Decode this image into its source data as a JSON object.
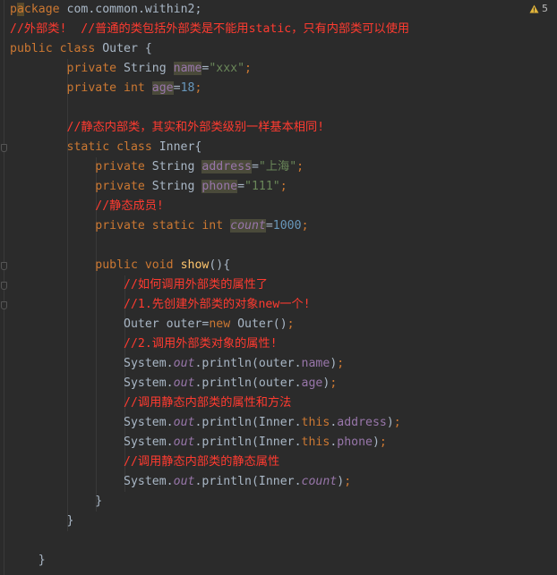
{
  "editor": {
    "warning_count": "5",
    "lines": [
      [
        {
          "t": "p",
          "c": "kw"
        },
        {
          "t": "a",
          "c": "caret-hl"
        },
        {
          "t": "ckage ",
          "c": "kw"
        },
        {
          "t": "com.common.within2;",
          "c": "plain"
        }
      ],
      [
        {
          "t": "//外部类!  //普通的类包括外部类是不能用static，只有内部类可以使用",
          "c": "cm"
        }
      ],
      [
        {
          "t": "public class ",
          "c": "kw"
        },
        {
          "t": "Outer {",
          "c": "plain"
        }
      ],
      [
        {
          "t": "        private ",
          "c": "kw"
        },
        {
          "t": "String ",
          "c": "plain"
        },
        {
          "t": "name",
          "c": "fld-hl"
        },
        {
          "t": "=",
          "c": "plain"
        },
        {
          "t": "\"xxx\"",
          "c": "str"
        },
        {
          "t": ";",
          "c": "kw"
        }
      ],
      [
        {
          "t": "        private int ",
          "c": "kw"
        },
        {
          "t": "age",
          "c": "fld-hl"
        },
        {
          "t": "=",
          "c": "plain"
        },
        {
          "t": "18",
          "c": "num"
        },
        {
          "t": ";",
          "c": "kw"
        }
      ],
      [],
      [
        {
          "t": "        //静态内部类，其实和外部类级别一样基本相同!",
          "c": "cm"
        }
      ],
      [
        {
          "t": "        static class ",
          "c": "kw"
        },
        {
          "t": "Inner{",
          "c": "plain"
        }
      ],
      [
        {
          "t": "            private ",
          "c": "kw"
        },
        {
          "t": "String ",
          "c": "plain"
        },
        {
          "t": "address",
          "c": "fld-hl"
        },
        {
          "t": "=",
          "c": "plain"
        },
        {
          "t": "\"上海\"",
          "c": "str"
        },
        {
          "t": ";",
          "c": "kw"
        }
      ],
      [
        {
          "t": "            private ",
          "c": "kw"
        },
        {
          "t": "String ",
          "c": "plain"
        },
        {
          "t": "phone",
          "c": "fld-hl"
        },
        {
          "t": "=",
          "c": "plain"
        },
        {
          "t": "\"111\"",
          "c": "str"
        },
        {
          "t": ";",
          "c": "kw"
        }
      ],
      [
        {
          "t": "            //静态成员!",
          "c": "cm"
        }
      ],
      [
        {
          "t": "            private static int ",
          "c": "kw"
        },
        {
          "t": "count",
          "c": "fld-it-hl"
        },
        {
          "t": "=",
          "c": "plain"
        },
        {
          "t": "1000",
          "c": "num"
        },
        {
          "t": ";",
          "c": "kw"
        }
      ],
      [],
      [
        {
          "t": "            public void ",
          "c": "kw"
        },
        {
          "t": "show",
          "c": "fn"
        },
        {
          "t": "(){",
          "c": "plain"
        }
      ],
      [
        {
          "t": "                //如何调用外部类的属性了",
          "c": "cm"
        }
      ],
      [
        {
          "t": "                //1.先创建外部类的对象new一个!",
          "c": "cm"
        }
      ],
      [
        {
          "t": "                Outer outer=",
          "c": "plain"
        },
        {
          "t": "new ",
          "c": "kw"
        },
        {
          "t": "Outer()",
          "c": "plain"
        },
        {
          "t": ";",
          "c": "kw"
        }
      ],
      [
        {
          "t": "                //2.调用外部类对象的属性!",
          "c": "cm"
        }
      ],
      [
        {
          "t": "                System.",
          "c": "plain"
        },
        {
          "t": "out",
          "c": "fld-it"
        },
        {
          "t": ".println(outer.",
          "c": "plain"
        },
        {
          "t": "name",
          "c": "fld"
        },
        {
          "t": ")",
          "c": "plain"
        },
        {
          "t": ";",
          "c": "kw"
        }
      ],
      [
        {
          "t": "                System.",
          "c": "plain"
        },
        {
          "t": "out",
          "c": "fld-it"
        },
        {
          "t": ".println(outer.",
          "c": "plain"
        },
        {
          "t": "age",
          "c": "fld"
        },
        {
          "t": ")",
          "c": "plain"
        },
        {
          "t": ";",
          "c": "kw"
        }
      ],
      [
        {
          "t": "                //调用静态内部类的属性和方法",
          "c": "cm"
        }
      ],
      [
        {
          "t": "                System.",
          "c": "plain"
        },
        {
          "t": "out",
          "c": "fld-it"
        },
        {
          "t": ".println(Inner.",
          "c": "plain"
        },
        {
          "t": "this",
          "c": "kw"
        },
        {
          "t": ".",
          "c": "plain"
        },
        {
          "t": "address",
          "c": "fld"
        },
        {
          "t": ")",
          "c": "plain"
        },
        {
          "t": ";",
          "c": "kw"
        }
      ],
      [
        {
          "t": "                System.",
          "c": "plain"
        },
        {
          "t": "out",
          "c": "fld-it"
        },
        {
          "t": ".println(Inner.",
          "c": "plain"
        },
        {
          "t": "this",
          "c": "kw"
        },
        {
          "t": ".",
          "c": "plain"
        },
        {
          "t": "phone",
          "c": "fld"
        },
        {
          "t": ")",
          "c": "plain"
        },
        {
          "t": ";",
          "c": "kw"
        }
      ],
      [
        {
          "t": "                //调用静态内部类的静态属性",
          "c": "cm"
        }
      ],
      [
        {
          "t": "                System.",
          "c": "plain"
        },
        {
          "t": "out",
          "c": "fld-it"
        },
        {
          "t": ".println(Inner.",
          "c": "plain"
        },
        {
          "t": "count",
          "c": "fld-it"
        },
        {
          "t": ")",
          "c": "plain"
        },
        {
          "t": ";",
          "c": "kw"
        }
      ],
      [
        {
          "t": "            }",
          "c": "plain"
        }
      ],
      [
        {
          "t": "        }",
          "c": "plain"
        }
      ],
      [],
      [
        {
          "t": "    }",
          "c": "plain"
        }
      ]
    ],
    "fold_lines": [
      7,
      13,
      14,
      15
    ]
  }
}
